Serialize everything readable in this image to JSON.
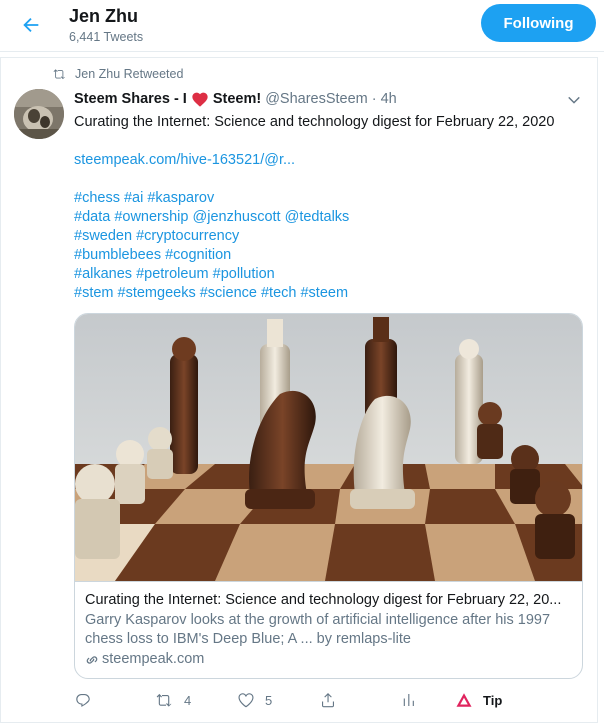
{
  "header": {
    "name": "Jen Zhu",
    "tweet_count": "6,441 Tweets",
    "follow_label": "Following",
    "back_icon": "back-arrow-icon"
  },
  "tweet": {
    "retweet_label": "Jen Zhu Retweeted",
    "display_name_part1": "Steem Shares - I",
    "display_name_part2": "Steem!",
    "handle": "@SharesSteem",
    "separator": "·",
    "time": "4h",
    "text": "Curating the Internet: Science and technology digest for February 22, 2020",
    "link": "steempeak.com/hive-163521/@r...",
    "hashtag_lines": [
      "#chess #ai #kasparov",
      "#data #ownership @jenzhuscott @tedtalks",
      "#sweden #cryptocurrency",
      "#bumblebees #cognition",
      "#alkanes #petroleum #pollution",
      "#stem #stemgeeks #science #tech #steem"
    ],
    "card": {
      "title": "Curating the Internet: Science and technology digest for February 22, 20...",
      "description_line1": "Garry Kasparov looks at the growth of artificial intelligence after his 1997",
      "description_line2": "chess loss to IBM's Deep Blue; A ... by remlaps-lite",
      "domain": "steempeak.com"
    },
    "actions": {
      "reply_count": "",
      "retweet_count": "4",
      "like_count": "5",
      "tip_label": "Tip"
    }
  },
  "colors": {
    "accent": "#1da1f2",
    "link": "#1b95e0",
    "secondary_text": "#657786",
    "heart": "#e0245e",
    "border": "#e6ecf0"
  }
}
